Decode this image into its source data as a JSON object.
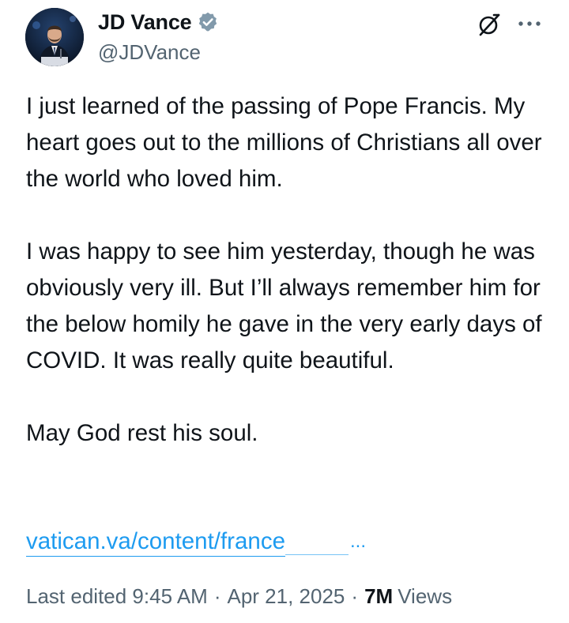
{
  "author": {
    "display_name": "JD Vance",
    "handle": "@JDVance",
    "verified_icon": "verified-badge-icon",
    "avatar_icon": "avatar"
  },
  "actions": {
    "grok_icon": "grok-icon",
    "more_icon": "more-options-icon"
  },
  "tweet": {
    "paragraphs": [
      "I just learned of the passing of Pope Francis. My heart goes out to the millions of Christians all over the world who loved him.",
      "I was happy to see him yesterday, though he was obviously very ill. But I’ll always remember him for the below homily he gave in the very early days of COVID. It was really quite beautiful.",
      "May God rest his soul."
    ],
    "link_text": "vatican.va/content/france",
    "link_ellipsis": "..."
  },
  "meta": {
    "edited_label": "Last edited 9:45 AM",
    "separator": "·",
    "date": "Apr 21, 2025",
    "views_count": "7M",
    "views_label": "Views"
  },
  "colors": {
    "text": "#0f1419",
    "secondary": "#536471",
    "link": "#1d9bf0",
    "verified": "#829aab"
  }
}
